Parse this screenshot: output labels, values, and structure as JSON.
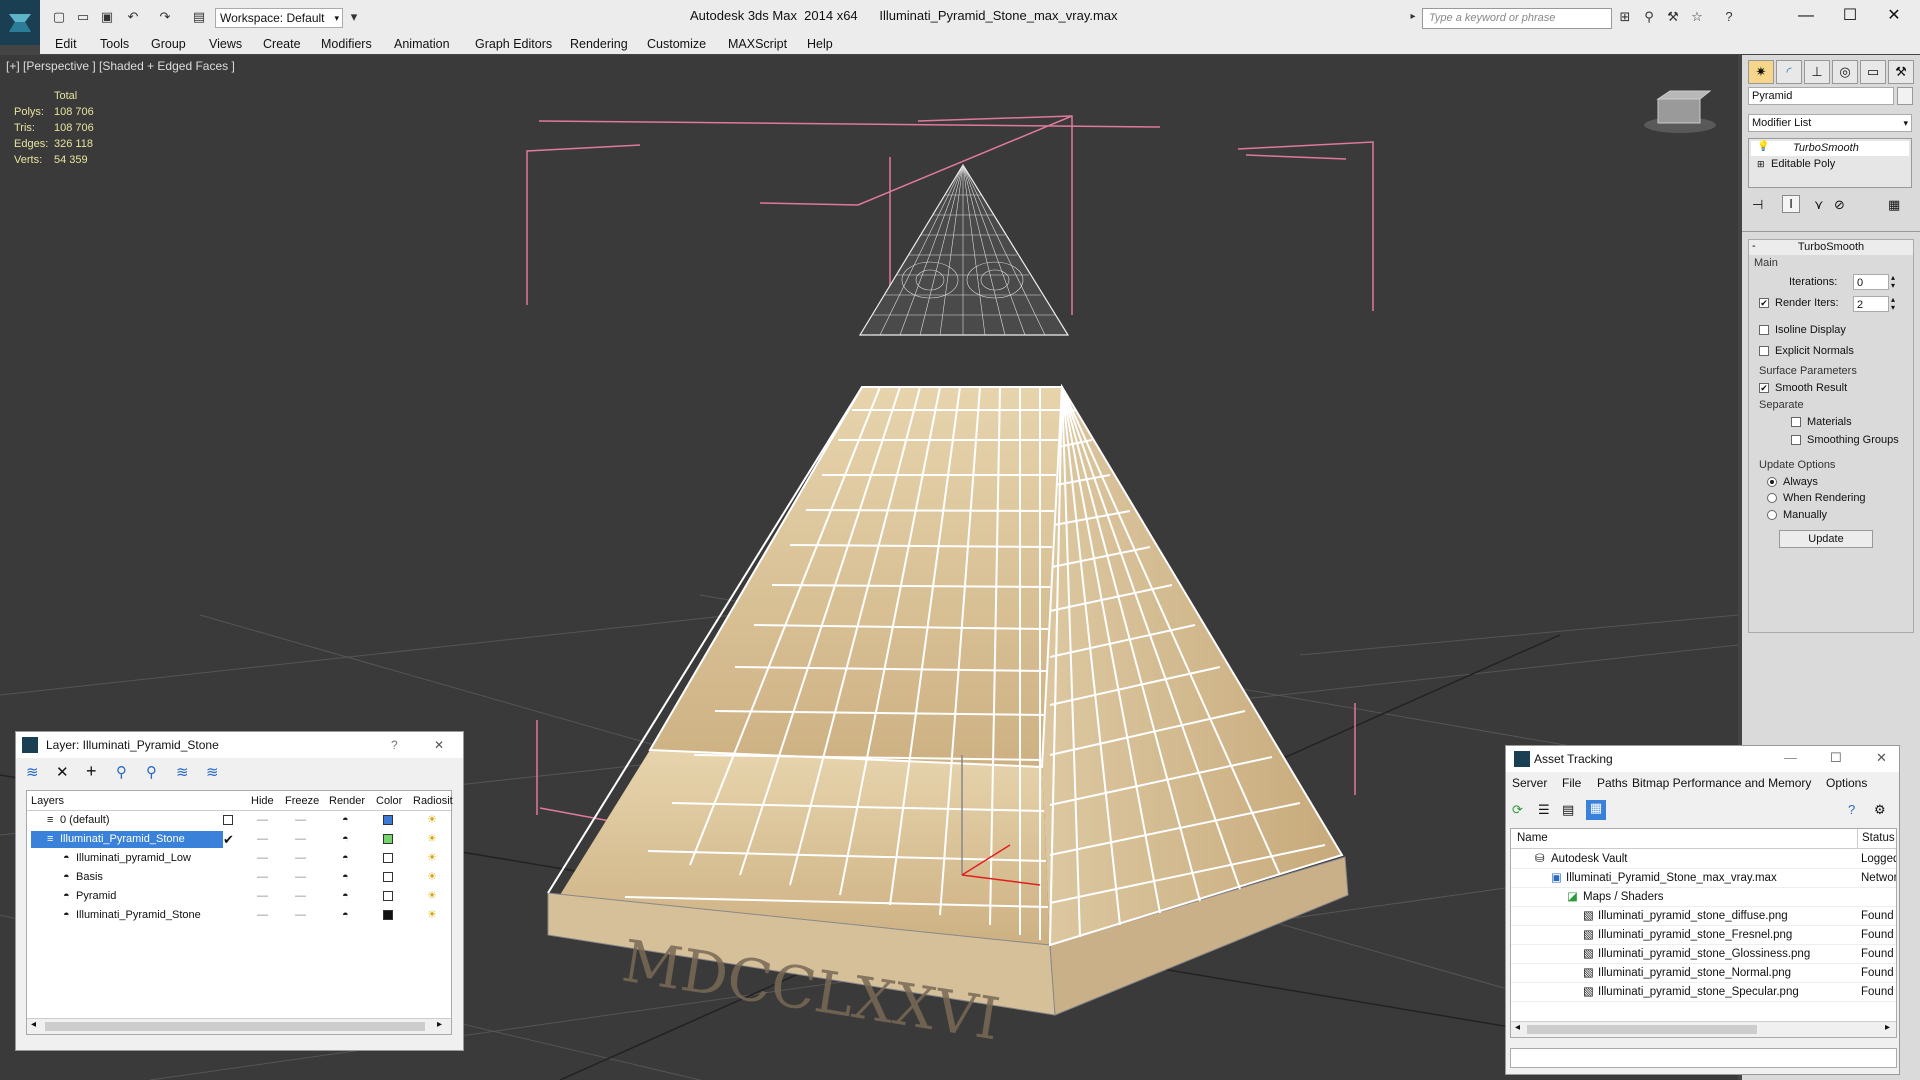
{
  "titlebar": {
    "workspace_label": "Workspace: Default",
    "title": "Autodesk 3ds Max  2014 x64      Illuminati_Pyramid_Stone_max_vray.max",
    "search_placeholder": "Type a keyword or phrase"
  },
  "menus": [
    "Edit",
    "Tools",
    "Group",
    "Views",
    "Create",
    "Modifiers",
    "Animation",
    "Graph Editors",
    "Rendering",
    "Customize",
    "MAXScript",
    "Help"
  ],
  "viewport": {
    "label": "[+] [Perspective ] [Shaded + Edged Faces ]",
    "stats": {
      "header": "Total",
      "rows": [
        {
          "label": "Polys:",
          "value": "108 706"
        },
        {
          "label": "Tris:",
          "value": "108 706"
        },
        {
          "label": "Edges:",
          "value": "326 118"
        },
        {
          "label": "Verts:",
          "value": "54 359"
        }
      ]
    },
    "base_inscription": "MDCCLXXVI"
  },
  "command_panel": {
    "object_name": "Pyramid",
    "modifier_list_label": "Modifier List",
    "stack": [
      "TurboSmooth",
      "Editable Poly"
    ],
    "turbosmooth": {
      "title": "TurboSmooth",
      "main_label": "Main",
      "iterations_label": "Iterations:",
      "iterations_value": "0",
      "render_iters_label": "Render Iters:",
      "render_iters_value": "2",
      "isoline_label": "Isoline Display",
      "explicit_normals_label": "Explicit Normals",
      "surface_params_label": "Surface Parameters",
      "smooth_result_label": "Smooth Result",
      "separate_label": "Separate",
      "materials_label": "Materials",
      "smoothing_groups_label": "Smoothing Groups",
      "update_options_label": "Update Options",
      "always_label": "Always",
      "when_rendering_label": "When Rendering",
      "manually_label": "Manually",
      "update_button": "Update"
    }
  },
  "layer_dialog": {
    "title": "Layer: Illuminati_Pyramid_Stone",
    "columns": [
      "Layers",
      "Hide",
      "Freeze",
      "Render",
      "Color",
      "Radiosit"
    ],
    "rows": [
      {
        "name": "0 (default)",
        "indent": 1,
        "color": "#3c7ad6"
      },
      {
        "name": "Illuminati_Pyramid_Stone",
        "indent": 1,
        "color": "#76d46e",
        "selected": true
      },
      {
        "name": "Illuminati_pyramid_Low",
        "indent": 2,
        "color": "#ffffff"
      },
      {
        "name": "Basis",
        "indent": 2,
        "color": "#ffffff"
      },
      {
        "name": "Pyramid",
        "indent": 2,
        "color": "#ffffff"
      },
      {
        "name": "Illuminati_Pyramid_Stone",
        "indent": 2,
        "color": "#111111"
      }
    ]
  },
  "asset_dialog": {
    "title": "Asset Tracking",
    "menus": [
      "Server",
      "File",
      "Paths",
      "Bitmap Performance and Memory",
      "Options"
    ],
    "columns": [
      "Name",
      "Status"
    ],
    "rows": [
      {
        "name": "Autodesk Vault",
        "status": "Logged",
        "indent": 1
      },
      {
        "name": "Illuminati_Pyramid_Stone_max_vray.max",
        "status": "Networ",
        "indent": 2
      },
      {
        "name": "Maps / Shaders",
        "status": "",
        "indent": 3
      },
      {
        "name": "Illuminati_pyramid_stone_diffuse.png",
        "status": "Found",
        "indent": 4
      },
      {
        "name": "Illuminati_pyramid_stone_Fresnel.png",
        "status": "Found",
        "indent": 4
      },
      {
        "name": "Illuminati_pyramid_stone_Glossiness.png",
        "status": "Found",
        "indent": 4
      },
      {
        "name": "Illuminati_pyramid_stone_Normal.png",
        "status": "Found",
        "indent": 4
      },
      {
        "name": "Illuminati_pyramid_stone_Specular.png",
        "status": "Found",
        "indent": 4
      }
    ]
  }
}
